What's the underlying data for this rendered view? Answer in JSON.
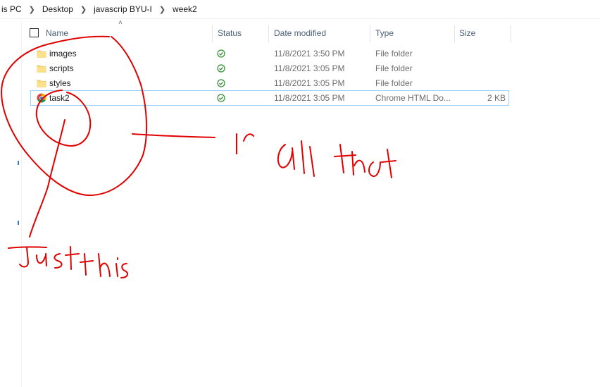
{
  "breadcrumb": {
    "items": [
      "is PC",
      "Desktop",
      "javascrip BYU-I",
      "week2"
    ]
  },
  "columns": {
    "name": "Name",
    "status": "Status",
    "date_modified": "Date modified",
    "type": "Type",
    "size": "Size"
  },
  "files": [
    {
      "name": "images",
      "status_icon": "synced-check-icon",
      "date": "11/8/2021 3:50 PM",
      "type": "File folder",
      "size": "",
      "icon": "folder-icon"
    },
    {
      "name": "scripts",
      "status_icon": "synced-check-icon",
      "date": "11/8/2021 3:05 PM",
      "type": "File folder",
      "size": "",
      "icon": "folder-icon"
    },
    {
      "name": "styles",
      "status_icon": "synced-check-icon",
      "date": "11/8/2021 3:05 PM",
      "type": "File folder",
      "size": "",
      "icon": "folder-icon"
    },
    {
      "name": "task2",
      "status_icon": "synced-check-icon",
      "date": "11/8/2021 3:05 PM",
      "type": "Chrome HTML Do...",
      "size": "2 KB",
      "icon": "chrome-icon",
      "selected": true
    }
  ],
  "annotations": {
    "color": "#e00000",
    "texts": [
      "or all that",
      "Just this"
    ]
  }
}
